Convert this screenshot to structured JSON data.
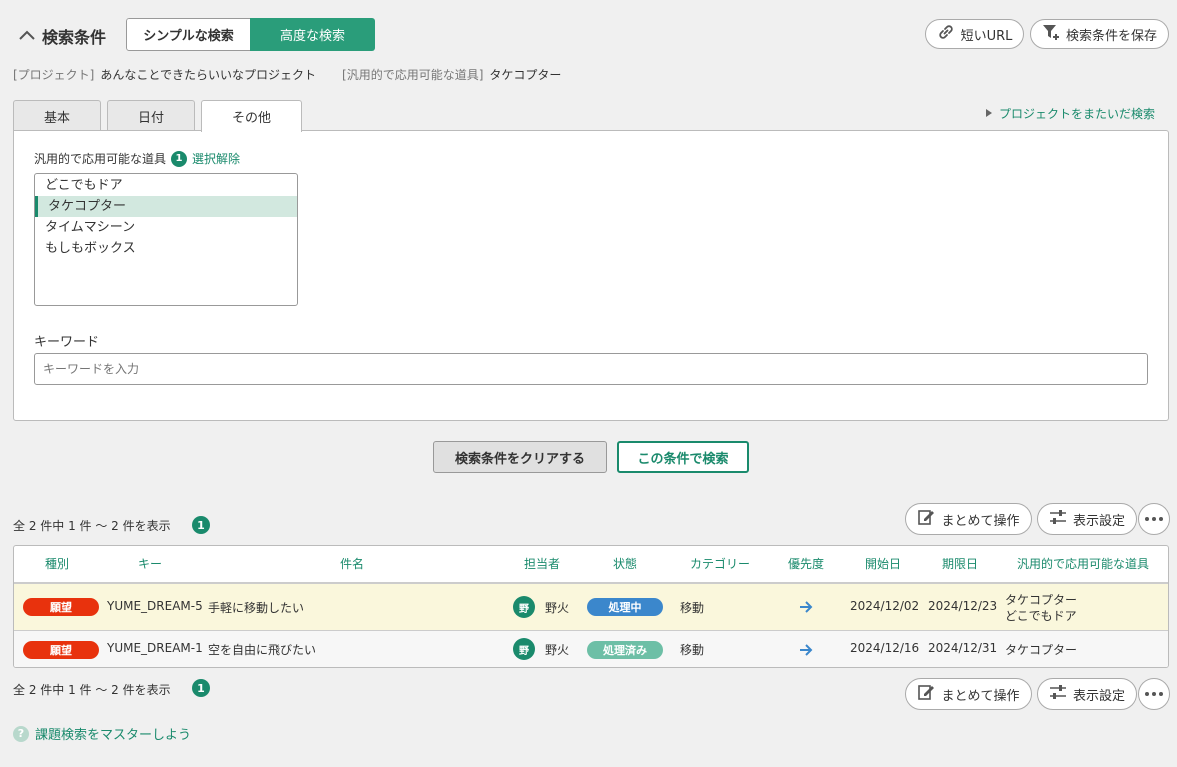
{
  "header": {
    "title": "検索条件",
    "mode_simple": "シンプルな検索",
    "mode_advanced": "高度な検索",
    "short_url": "短いURL",
    "save_condition": "検索条件を保存"
  },
  "filters_summary": {
    "project_label": "[プロジェクト]",
    "project_value": "あんなことできたらいいなプロジェクト",
    "field_label": "[汎用的で応用可能な道具]",
    "field_value": "タケコプター"
  },
  "tabs": [
    "基本",
    "日付",
    "その他"
  ],
  "cross_project": "プロジェクトをまたいだ検索",
  "tool_filter": {
    "label": "汎用的で応用可能な道具",
    "count": "1",
    "clear": "選択解除",
    "options": [
      "どこでもドア",
      "タケコプター",
      "タイムマシーン",
      "もしもボックス"
    ],
    "selected": "タケコプター"
  },
  "keyword": {
    "label": "キーワード",
    "placeholder": "キーワードを入力"
  },
  "actions": {
    "clear": "検索条件をクリアする",
    "search": "この条件で検索"
  },
  "results": {
    "summary": "全 2 件中 1 件 〜 2 件を表示",
    "count": "1",
    "bulk": "まとめて操作",
    "display_settings": "表示設定"
  },
  "table": {
    "columns": [
      "種別",
      "キー",
      "件名",
      "担当者",
      "状態",
      "カテゴリー",
      "優先度",
      "開始日",
      "期限日",
      "汎用的で応用可能な道具"
    ],
    "rows": [
      {
        "type": "願望",
        "key": "YUME_DREAM-5",
        "subject": "手軽に移動したい",
        "assignee_initial": "野",
        "assignee": "野火",
        "status": "処理中",
        "status_color": "#3b87cc",
        "category": "移動",
        "priority": "→",
        "start": "2024/12/02",
        "due": "2024/12/23",
        "tool1": "タケコプター",
        "tool2": "どこでもドア"
      },
      {
        "type": "願望",
        "key": "YUME_DREAM-1",
        "subject": "空を自由に飛びたい",
        "assignee_initial": "野",
        "assignee": "野火",
        "status": "処理済み",
        "status_color": "#6dbfa6",
        "category": "移動",
        "priority": "→",
        "start": "2024/12/16",
        "due": "2024/12/31",
        "tool1": "タケコプター",
        "tool2": ""
      }
    ]
  },
  "help_link": "課題検索をマスターしよう",
  "colors": {
    "accent": "#1a8a6c",
    "type_badge": "#e8320d"
  }
}
